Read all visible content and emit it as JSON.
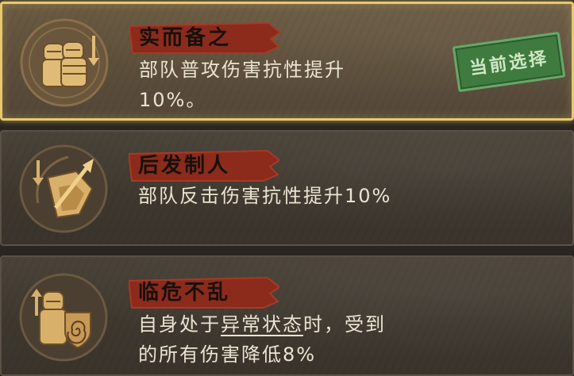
{
  "skills": [
    {
      "name": "实而备之",
      "desc_line1": "部队普攻伤害抗性提升",
      "desc_line2": "10%。",
      "badge": "当前选择",
      "icon": "soldier-shield-defense-icon"
    },
    {
      "name": "后发制人",
      "desc_line1": "部队反击伤害抗性提升10%",
      "icon": "counter-attack-shield-icon"
    },
    {
      "name": "临危不乱",
      "desc_line1_pre": "自身处于",
      "desc_line1_link": "异常状态",
      "desc_line1_post": "时，受到",
      "desc_line2": "的所有伤害降低8%",
      "icon": "soldier-spiral-shield-icon"
    }
  ],
  "colors": {
    "selected_border": "#e8c96b",
    "banner_red": "#8c2a1c",
    "icon_gold": "#d9b06a",
    "stamp_green": "#3f7a3f"
  }
}
